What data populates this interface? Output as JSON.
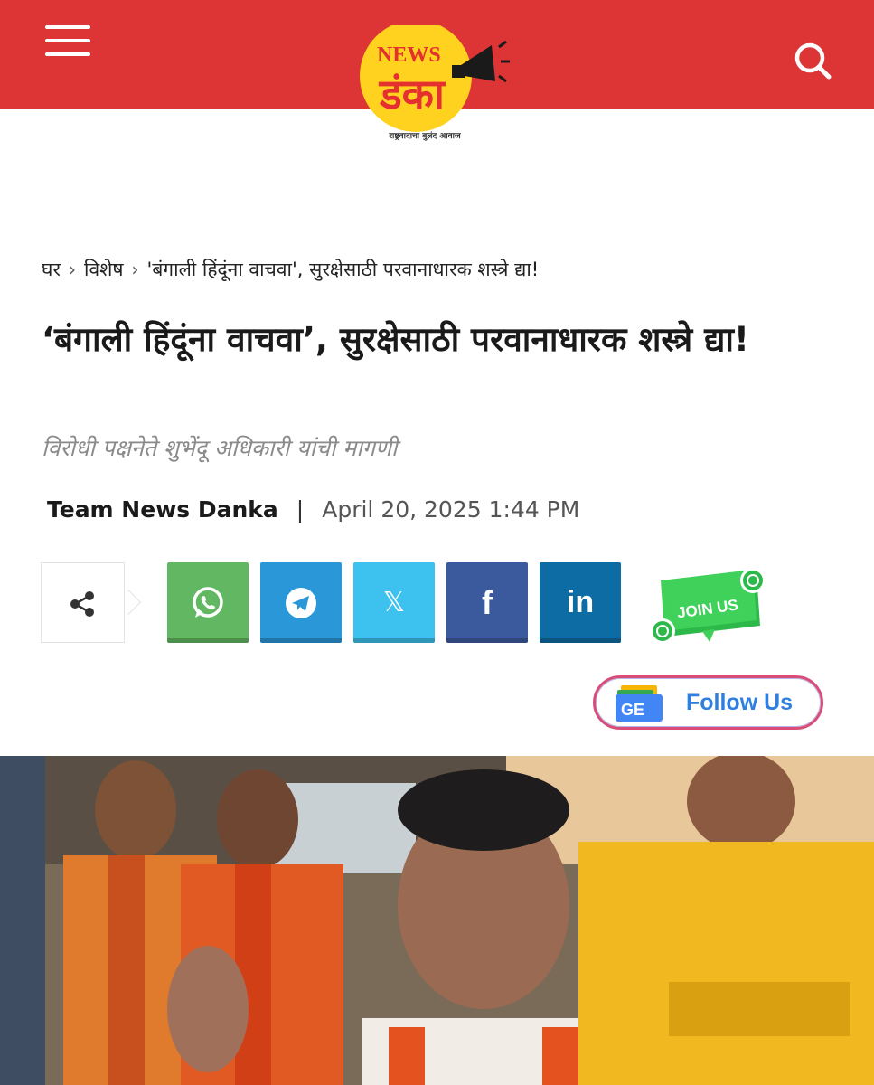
{
  "header": {
    "logo_news": "NEWS",
    "logo_main": "डंका",
    "logo_tagline": "राष्ट्रवादाचा बुलंद आवाज"
  },
  "breadcrumb": {
    "home": "घर",
    "category": "विशेष",
    "current": "'बंगाली हिंदूंना वाचवा', सुरक्षेसाठी परवानाधारक शस्त्रे द्या!"
  },
  "article": {
    "title": "‘बंगाली हिंदूंना वाचवा’, सुरक्षेसाठी परवानाधारक शस्त्रे द्या!",
    "subtitle": "विरोधी पक्षनेते शुभेंदू अधिकारी यांची मागणी",
    "author": "Team News Danka",
    "separator": "|",
    "date": "April 20, 2025 1:44 PM"
  },
  "social": {
    "twitter_glyph": "𝕏",
    "facebook_glyph": "f",
    "linkedin_glyph": "in"
  },
  "join_us": {
    "label": "JOIN US"
  },
  "follow": {
    "label": "Follow Us",
    "icon_text": "GE"
  },
  "colors": {
    "header_bg": "#dd3535",
    "whatsapp": "#62b862",
    "telegram": "#2a98d8",
    "twitter": "#3dc1ee",
    "facebook": "#3b5a9e",
    "linkedin": "#0d6ca3"
  },
  "icons": [
    "menu-icon",
    "search-icon",
    "share-icon",
    "whatsapp-icon",
    "telegram-icon",
    "x-icon",
    "facebook-icon",
    "linkedin-icon",
    "google-news-icon",
    "megaphone-icon"
  ]
}
